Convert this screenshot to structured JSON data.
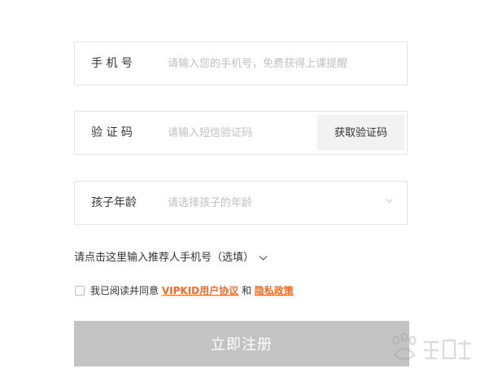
{
  "form": {
    "phone": {
      "label": "手 机 号",
      "placeholder": "请输入您的手机号，免费获得上课提醒",
      "value": ""
    },
    "code": {
      "label": "验 证 码",
      "placeholder": "请输入短信验证码",
      "value": "",
      "button_label": "获取验证码"
    },
    "age": {
      "label": "孩子年龄",
      "placeholder": "请选择孩子的年龄",
      "icon": "chevron-down-icon"
    },
    "referral_text": "请点击这里输入推荐人手机号（选填）",
    "agreement": {
      "checked": false,
      "prefix": "我已阅读并同意",
      "terms_link": "VIPKID用户协议",
      "conjunction": "和",
      "privacy_link": "隐私政策"
    },
    "submit_label": "立即注册"
  },
  "colors": {
    "border": "#e4e4e4",
    "link": "#f26b2a",
    "submit_bg": "#c3c3c3",
    "code_button_bg": "#f2f2f2",
    "placeholder": "#bfbfbf"
  }
}
